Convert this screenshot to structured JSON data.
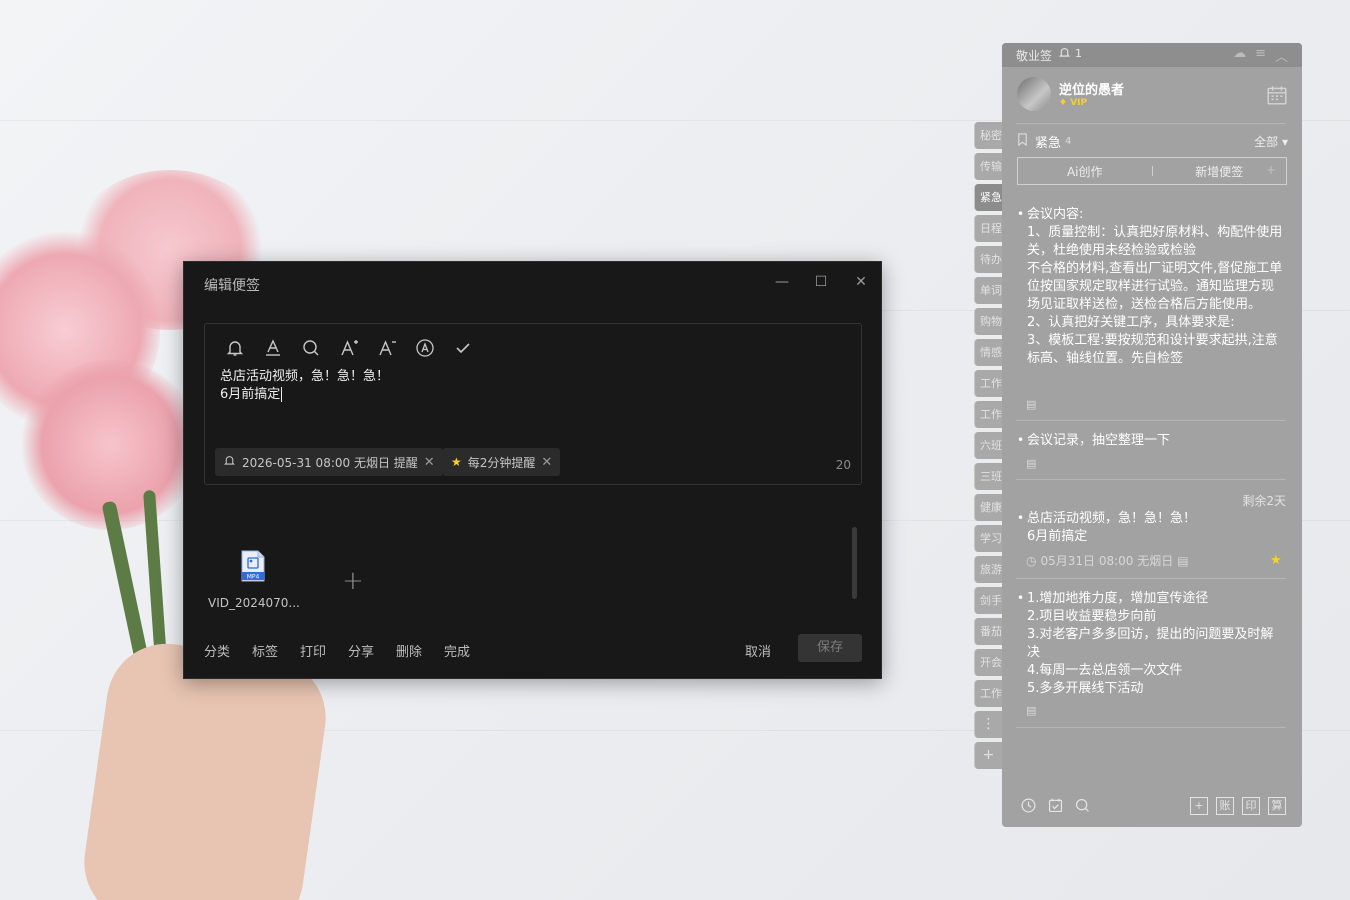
{
  "editor": {
    "title": "编辑便签",
    "note_line1": "总店活动视频，急！急！急！",
    "note_line2": "6月前搞定",
    "reminder_chip": "2026-05-31 08:00 无烟日 提醒",
    "repeat_chip": "每2分钟提醒",
    "char_count": "20",
    "attachment_name": "VID_2024070...",
    "attachment_badge": "MP4",
    "footer": {
      "category": "分类",
      "tag": "标签",
      "print": "打印",
      "share": "分享",
      "delete": "删除",
      "done": "完成",
      "cancel": "取消",
      "save": "保存"
    }
  },
  "sidetabs": [
    "秘密",
    "传输",
    "紧急",
    "日程",
    "待办",
    "单词",
    "购物",
    "情感",
    "工作",
    "工作",
    "六班",
    "三班",
    "健康",
    "学习",
    "旅游",
    "剑手",
    "番茄",
    "开会",
    "工作"
  ],
  "panel": {
    "app_name": "敬业签",
    "notif_count": "1",
    "username": "逆位的愚者",
    "vip": "VIP",
    "category": "紧急",
    "category_count": "4",
    "filter": "全部",
    "ai_create": "Ai创作",
    "new_note": "新增便签",
    "notes": [
      {
        "text": "会议内容:\n1、质量控制：认真把好原材料、构配件使用关，杜绝使用未经检验或检验\n不合格的材料,查看出厂证明文件,督促施工单位按国家规定取样进行试验。通知监理方现场见证取样送检，送检合格后方能使用。\n2、认真把好关键工序，具体要求是:\n3、模板工程:要按规范和设计要求起拱,注意标高、轴线位置。先自检签"
      },
      {
        "text": "会议记录，抽空整理一下"
      },
      {
        "text": "总店活动视频，急！急！急！\n6月前搞定",
        "remain": "剩余2天",
        "meta": "05月31日 08:00 无烟日"
      },
      {
        "text": "1.增加地推力度，增加宣传途径\n2.项目收益要稳步向前\n3.对老客户多多回访，提出的问题要及时解决\n4.每周一去总店领一次文件\n5.多多开展线下活动"
      }
    ],
    "footer_right": [
      "+",
      "账",
      "印",
      "算"
    ]
  },
  "colors": {
    "editor_bg": "#181818",
    "panel_bg": "#a2a2a2",
    "star": "#f8d12d"
  }
}
